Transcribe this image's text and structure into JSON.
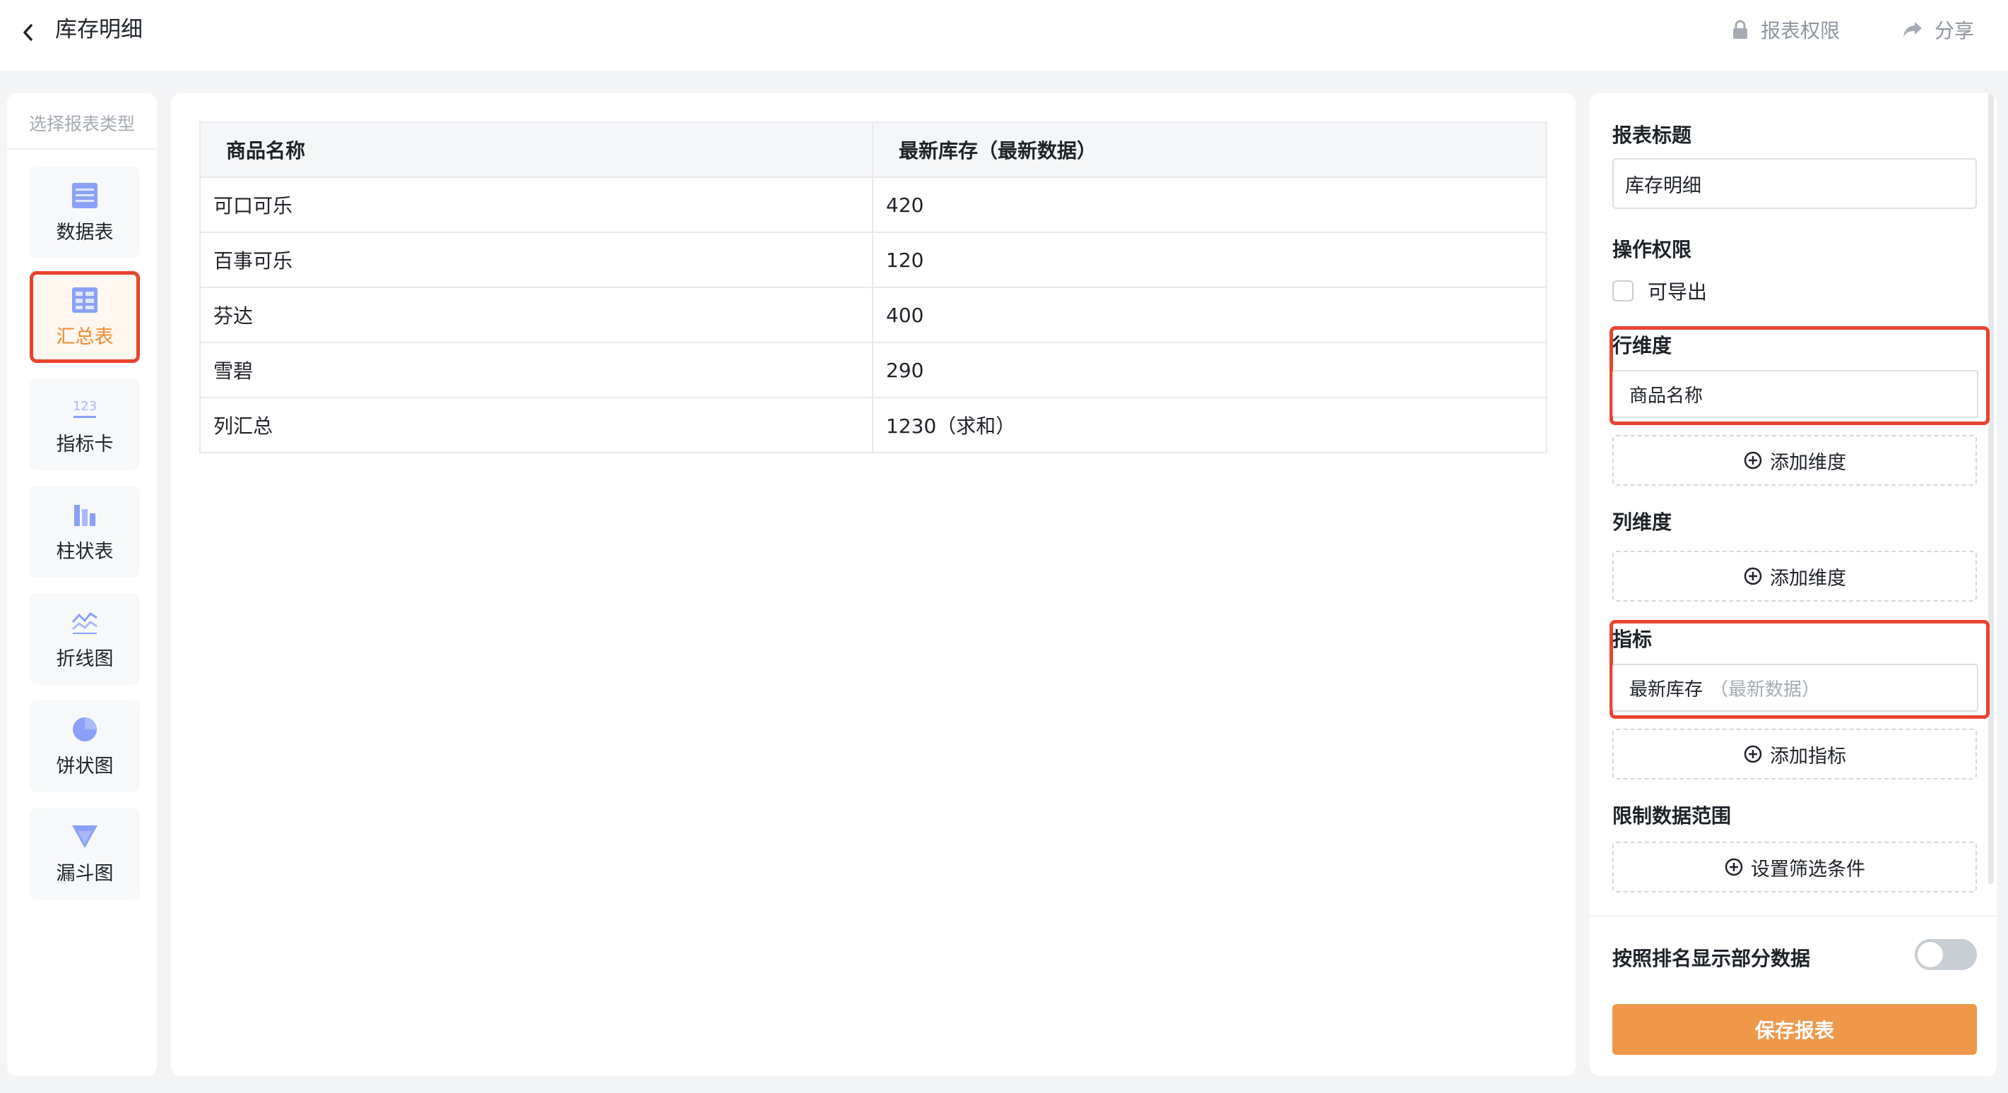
{
  "header": {
    "title": "库存明细",
    "permission_label": "报表权限",
    "share_label": "分享"
  },
  "type_panel": {
    "label": "选择报表类型",
    "items": [
      {
        "label": "数据表",
        "icon": "table-icon"
      },
      {
        "label": "汇总表",
        "icon": "summary-table-icon",
        "active": true
      },
      {
        "label": "指标卡",
        "icon": "number-card-icon"
      },
      {
        "label": "柱状表",
        "icon": "bar-chart-icon"
      },
      {
        "label": "折线图",
        "icon": "line-chart-icon"
      },
      {
        "label": "饼状图",
        "icon": "pie-chart-icon"
      },
      {
        "label": "漏斗图",
        "icon": "funnel-chart-icon"
      }
    ]
  },
  "table": {
    "headers": [
      "商品名称",
      "最新库存（最新数据）"
    ],
    "rows": [
      [
        "可口可乐",
        "420"
      ],
      [
        "百事可乐",
        "120"
      ],
      [
        "芬达",
        "400"
      ],
      [
        "雪碧",
        "290"
      ],
      [
        "列汇总",
        "1230（求和）"
      ]
    ]
  },
  "config": {
    "title_label": "报表标题",
    "title_value": "库存明细",
    "permission_label": "操作权限",
    "export_label": "可导出",
    "row_dim_label": "行维度",
    "row_dim_field": "商品名称",
    "add_dimension_label": "添加维度",
    "col_dim_label": "列维度",
    "metric_label": "指标",
    "metric_field": "最新库存",
    "metric_field_sub": "（最新数据）",
    "add_metric_label": "添加指标",
    "range_label": "限制数据范围",
    "filter_label": "设置筛选条件",
    "rank_toggle_label": "按照排名显示部分数据",
    "save_label": "保存报表"
  },
  "colors": {
    "accent": "#f0984a",
    "highlight": "#e8432f",
    "icon_blue": "#8aa1f7"
  }
}
